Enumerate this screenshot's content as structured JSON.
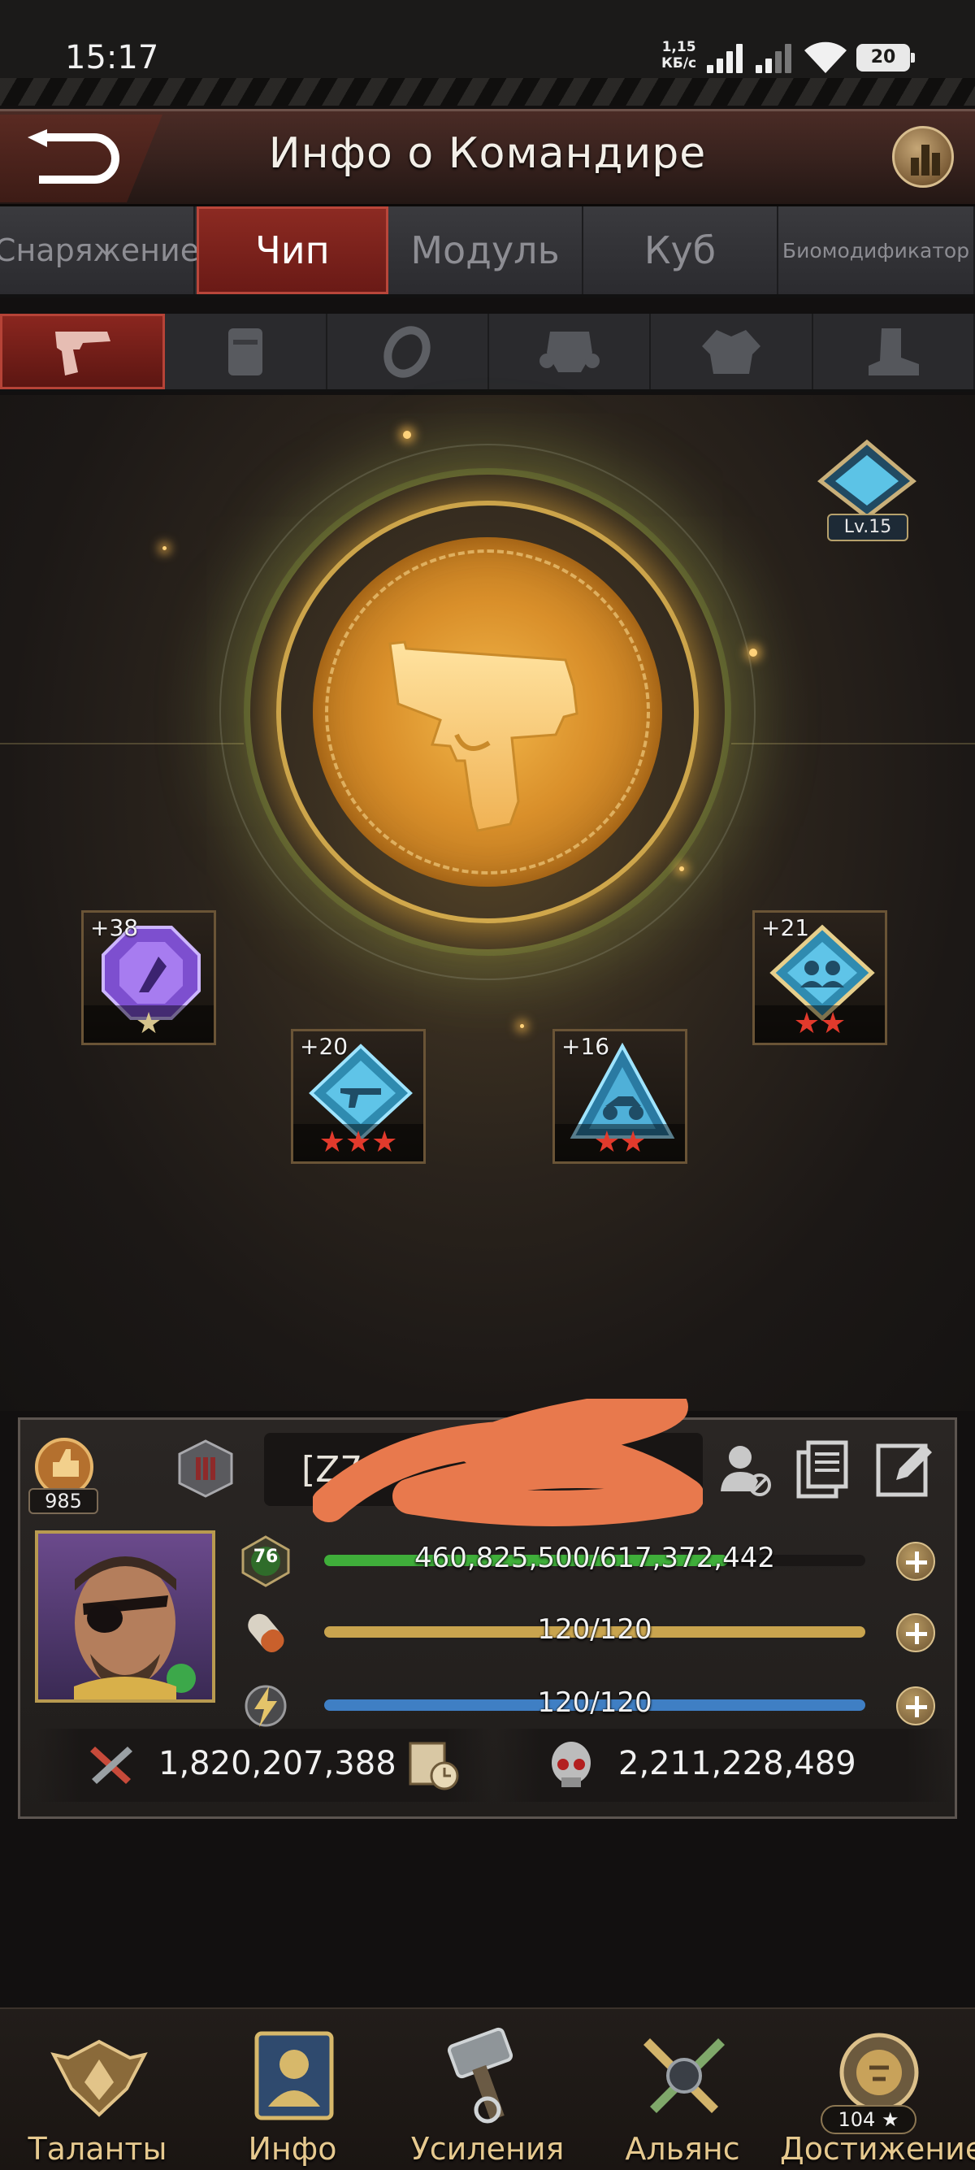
{
  "status_bar": {
    "time": "15:17",
    "net_speed_value": "1,15",
    "net_speed_unit": "КБ/с",
    "battery": "20"
  },
  "header": {
    "title": "Инфо о Командире"
  },
  "tabs": [
    {
      "label": "Снаряжение",
      "active": false
    },
    {
      "label": "Чип",
      "active": true
    },
    {
      "label": "Модуль",
      "active": false
    },
    {
      "label": "Куб",
      "active": false
    },
    {
      "label": "Биомодификатор",
      "active": false
    }
  ],
  "gear_slots": [
    {
      "icon": "pistol-icon",
      "active": true
    },
    {
      "icon": "vest-icon",
      "active": false
    },
    {
      "icon": "ring-icon",
      "active": false
    },
    {
      "icon": "gas-mask-icon",
      "active": false
    },
    {
      "icon": "armor-icon",
      "active": false
    },
    {
      "icon": "boot-icon",
      "active": false
    }
  ],
  "chip_level": "Lv.15",
  "chips": [
    {
      "bonus": "+38",
      "stars": "★",
      "color": "#8a5cd6"
    },
    {
      "bonus": "+20",
      "stars": "★★★",
      "color": "#3fa7c9"
    },
    {
      "bonus": "+16",
      "stars": "★★",
      "color": "#3a9ac2"
    },
    {
      "bonus": "+21",
      "stars": "★★",
      "color": "#3fa7c9"
    }
  ],
  "commander": {
    "rank_count": "985",
    "name_visible": "[Z7",
    "level": "76",
    "exp": "460,825,500/617,372,442",
    "exp_fraction": 0.746,
    "stamina": "120/120",
    "energy": "120/120",
    "power": "1,820,207,388",
    "kills": "2,211,228,489"
  },
  "colors": {
    "accent_red": "#8c2a22",
    "exp_green": "#3fae3a",
    "stamina_gold": "#c9a44e",
    "energy_blue": "#3f7fc4",
    "nav_label": "#e6c98f"
  },
  "bottom_nav": [
    {
      "label": "Таланты",
      "icon": "talent-wings-icon"
    },
    {
      "label": "Инфо",
      "icon": "info-portrait-icon"
    },
    {
      "label": "Усиления",
      "icon": "hammer-icon"
    },
    {
      "label": "Альянс",
      "icon": "crossed-swords-icon"
    },
    {
      "label": "Достижение",
      "icon": "lion-badge-icon",
      "badge": "104 ★"
    }
  ]
}
